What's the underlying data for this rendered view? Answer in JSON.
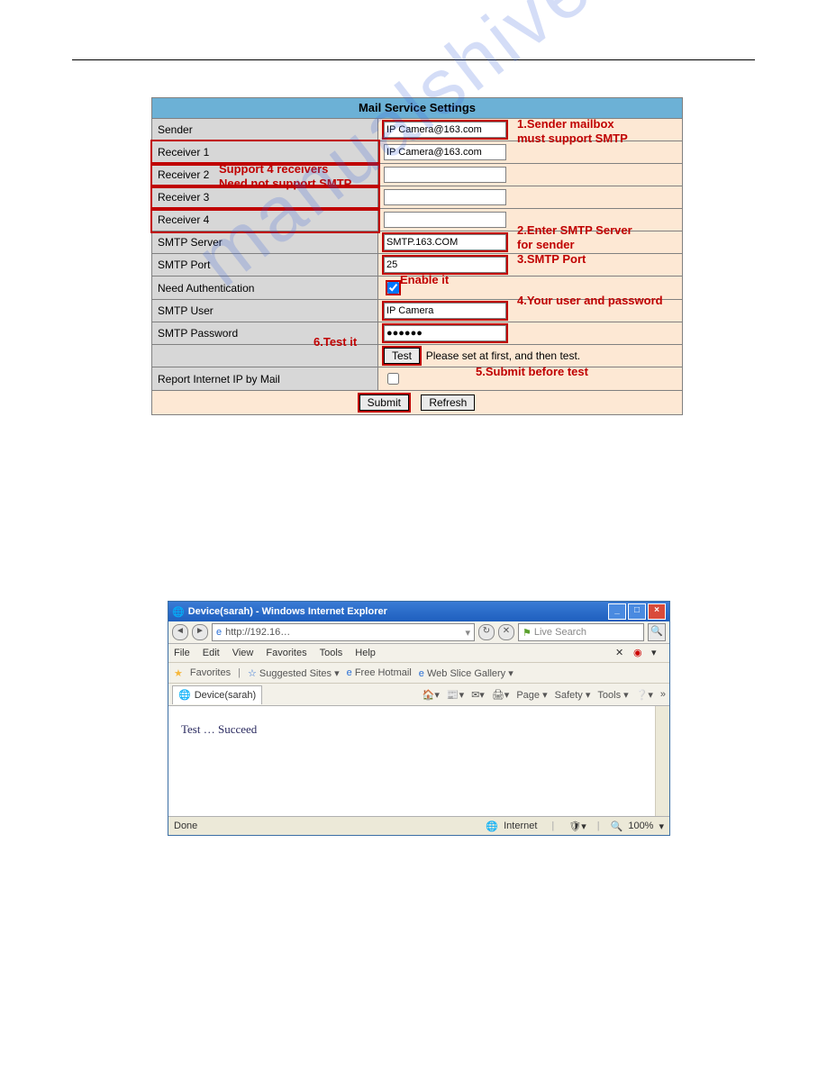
{
  "watermark": "manualshive.com",
  "mail": {
    "title": "Mail Service Settings",
    "rows": {
      "sender": "Sender",
      "r1": "Receiver 1",
      "r2": "Receiver 2",
      "r3": "Receiver 3",
      "r4": "Receiver 4",
      "server": "SMTP Server",
      "port": "SMTP Port",
      "auth": "Need Authentication",
      "user": "SMTP User",
      "pass": "SMTP Password",
      "report": "Report Internet IP by Mail"
    },
    "values": {
      "sender": "IP Camera@163.com",
      "r1": "IP Camera@163.com",
      "r2": "",
      "r3": "",
      "r4": "",
      "server": "SMTP.163.COM",
      "port": "25",
      "user": "IP Camera",
      "pass": "●●●●●●"
    },
    "test_btn": "Test",
    "test_hint": "Please set at first, and then test.",
    "submit": "Submit",
    "refresh": "Refresh"
  },
  "ann": {
    "a1a": "1.Sender mailbox",
    "a1b": "must support SMTP",
    "a2a": "Support 4 receivers",
    "a2b": "Need not support SMTP",
    "a3a": "2.Enter SMTP Server",
    "a3b": "for sender",
    "a4": "3.SMTP Port",
    "a5": "Enable it",
    "a6": "4.Your user and password",
    "a7": "6.Test it",
    "a8": "5.Submit before test"
  },
  "ie": {
    "title": "Device(sarah) - Windows Internet Explorer",
    "url": "http://192.16…",
    "search_ph": "Live Search",
    "menu": {
      "file": "File",
      "edit": "Edit",
      "view": "View",
      "fav": "Favorites",
      "tools": "Tools",
      "help": "Help"
    },
    "favbar": {
      "label": "Favorites",
      "s1": "Suggested Sites",
      "s2": "Free Hotmail",
      "s3": "Web Slice Gallery"
    },
    "tab": "Device(sarah)",
    "cmd": {
      "page": "Page",
      "safety": "Safety",
      "tools": "Tools"
    },
    "body": "Test  …  Succeed",
    "status_left": "Done",
    "status_zone": "Internet",
    "status_zoom": "100%"
  }
}
